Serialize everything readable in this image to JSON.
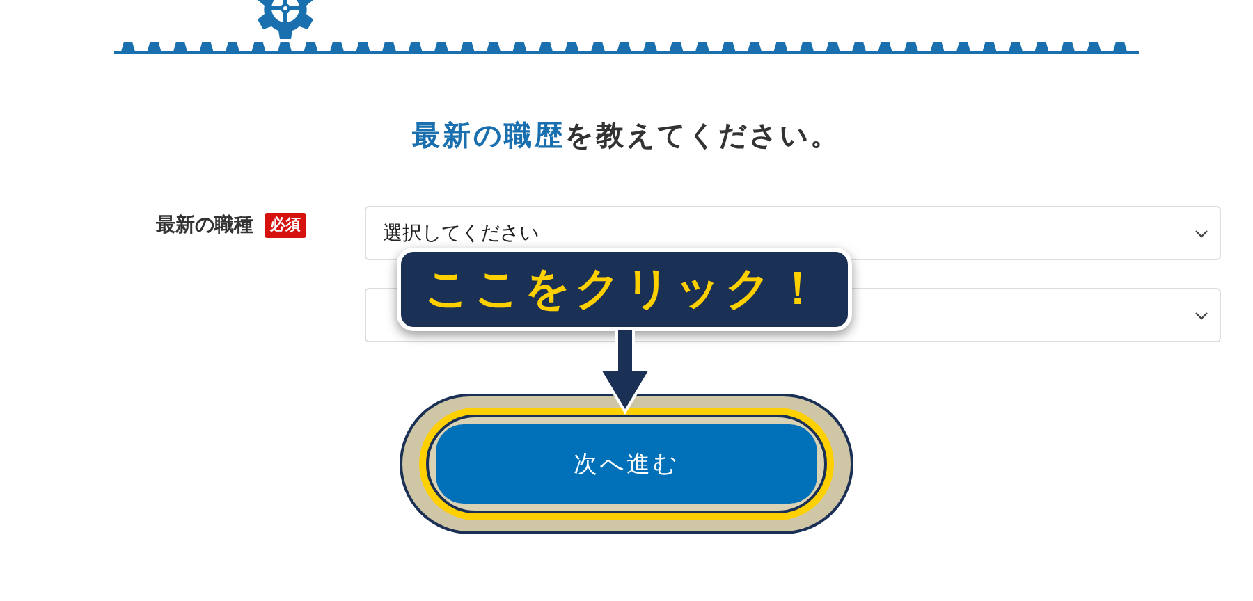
{
  "heading": {
    "lead": "最新の職歴",
    "rest": "を教えてください。"
  },
  "field": {
    "label": "最新の職種",
    "required_badge": "必須",
    "selects": [
      {
        "kind": "filled",
        "value": "選択してください"
      },
      {
        "kind": "empty"
      }
    ]
  },
  "callout": {
    "text": "ここをクリック！"
  },
  "next_button": {
    "label": "次へ進む"
  }
}
